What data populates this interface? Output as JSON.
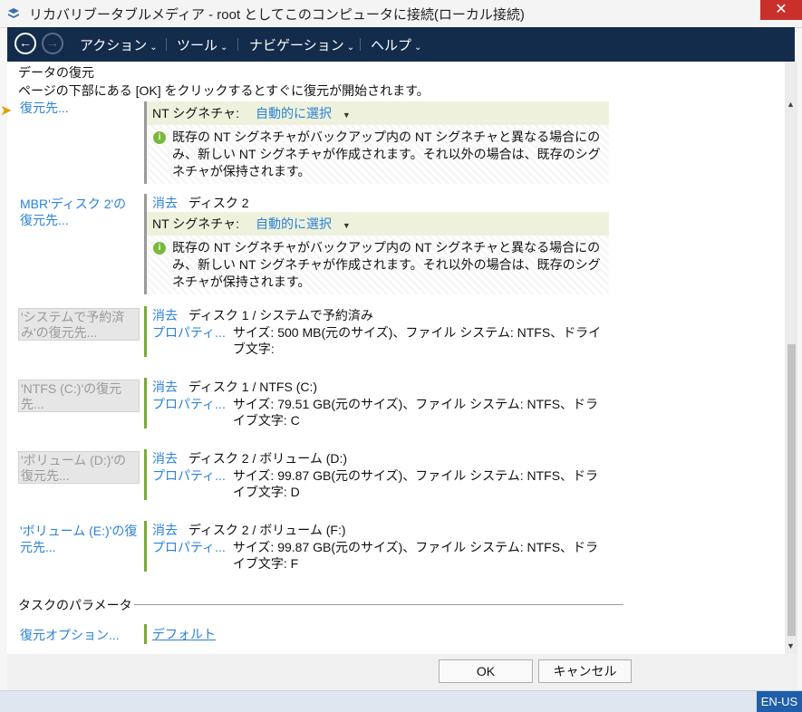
{
  "window": {
    "title": "リカバリブータブルメディア - root としてこのコンピュータに接続(ローカル接続)",
    "close_label": "✕"
  },
  "toolbar": {
    "back_icon": "←",
    "forward_icon": "→",
    "menus": [
      "アクション",
      "ツール",
      "ナビゲーション",
      "ヘルプ"
    ]
  },
  "header": {
    "title": "データの復元",
    "description": "ページの下部にある [OK] をクリックするとすぐに復元が開始されます。"
  },
  "sections": [
    {
      "label": "復元先...",
      "nt_signature": {
        "label": "NT シグネチャ:",
        "value": "自動的に選択"
      },
      "info": "既存の NT シグネチャがバックアップ内の NT シグネチャと異なる場合にのみ、新しい NT シグネチャが作成されます。それ以外の場合は、既存のシグネチャが保持されます。"
    },
    {
      "label": "MBR'ディスク 2'の復元先...",
      "clear_label": "消去",
      "target": "ディスク 2",
      "nt_signature": {
        "label": "NT シグネチャ:",
        "value": "自動的に選択"
      },
      "info": "既存の NT シグネチャがバックアップ内の NT シグネチャと異なる場合にのみ、新しい NT シグネチャが作成されます。それ以外の場合は、既存のシグネチャが保持されます。"
    },
    {
      "label": "'システムで予約済み'の復元先...",
      "clear_label": "消去",
      "target": "ディスク 1 / システムで予約済み",
      "properties_label": "プロパティ...",
      "details": "サイズ: 500 MB(元のサイズ)、ファイル システム: NTFS、ドライブ文字:"
    },
    {
      "label": "'NTFS (C:)'の復元先...",
      "clear_label": "消去",
      "target": "ディスク 1 / NTFS (C:)",
      "properties_label": "プロパティ...",
      "details": "サイズ: 79.51 GB(元のサイズ)、ファイル システム: NTFS、ドライブ文字: C"
    },
    {
      "label": "'ボリューム (D:)'の復元先...",
      "clear_label": "消去",
      "target": "ディスク 2 / ボリューム (D:)",
      "properties_label": "プロパティ...",
      "details": "サイズ: 99.87 GB(元のサイズ)、ファイル システム: NTFS、ドライブ文字: D"
    },
    {
      "label": "'ボリューム (E:)'の復元先...",
      "clear_label": "消去",
      "target": "ディスク 2 / ボリューム (F:)",
      "properties_label": "プロパティ...",
      "details": "サイズ: 99.87 GB(元のサイズ)、ファイル システム: NTFS、ドライブ文字: F"
    }
  ],
  "task_params": {
    "title": "タスクのパラメータ",
    "option_label": "復元オプション...",
    "option_value": "デフォルト"
  },
  "footer": {
    "ok_label": "OK",
    "cancel_label": "キャンセル"
  },
  "statusbar": {
    "language": "EN-US"
  },
  "colors": {
    "accent": "#2b82d9",
    "toolbar": "#142c4b",
    "green_bar": "#79a93a",
    "close": "#c9302c"
  }
}
